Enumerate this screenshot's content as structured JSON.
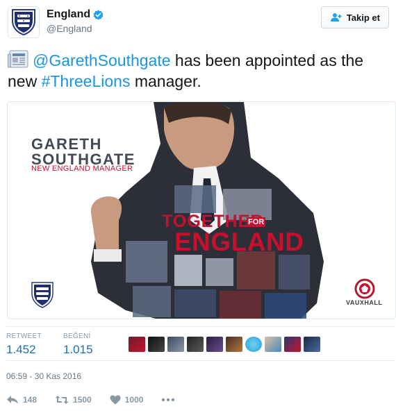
{
  "account": {
    "display_name": "England",
    "handle": "@England",
    "verified": true
  },
  "follow_button": {
    "label": "Takip et"
  },
  "tweet": {
    "mention": "@GarethSouthgate",
    "text_mid": " has been appointed as the new ",
    "hashtag": "#ThreeLions",
    "text_end": " manager."
  },
  "media": {
    "name": "GARETH\nSOUTHGATE",
    "name_line1": "GARETH",
    "name_line2": "SOUTHGATE",
    "subtitle": "NEW ENGLAND MANAGER",
    "together": "TOGETHER",
    "for": "FOR",
    "england": "ENGLAND",
    "sponsor": "VAUXHALL"
  },
  "stats": {
    "retweets_label": "RETWEET",
    "retweets_value": "1.452",
    "likes_label": "BEĞENİ",
    "likes_value": "1.015"
  },
  "timestamp": "06:59 - 30 Kas 2016",
  "actions": {
    "reply_count": "148",
    "retweet_count": "1500",
    "like_count": "1000"
  },
  "colors": {
    "link": "#1b95e0",
    "accent_red": "#c8102e"
  }
}
